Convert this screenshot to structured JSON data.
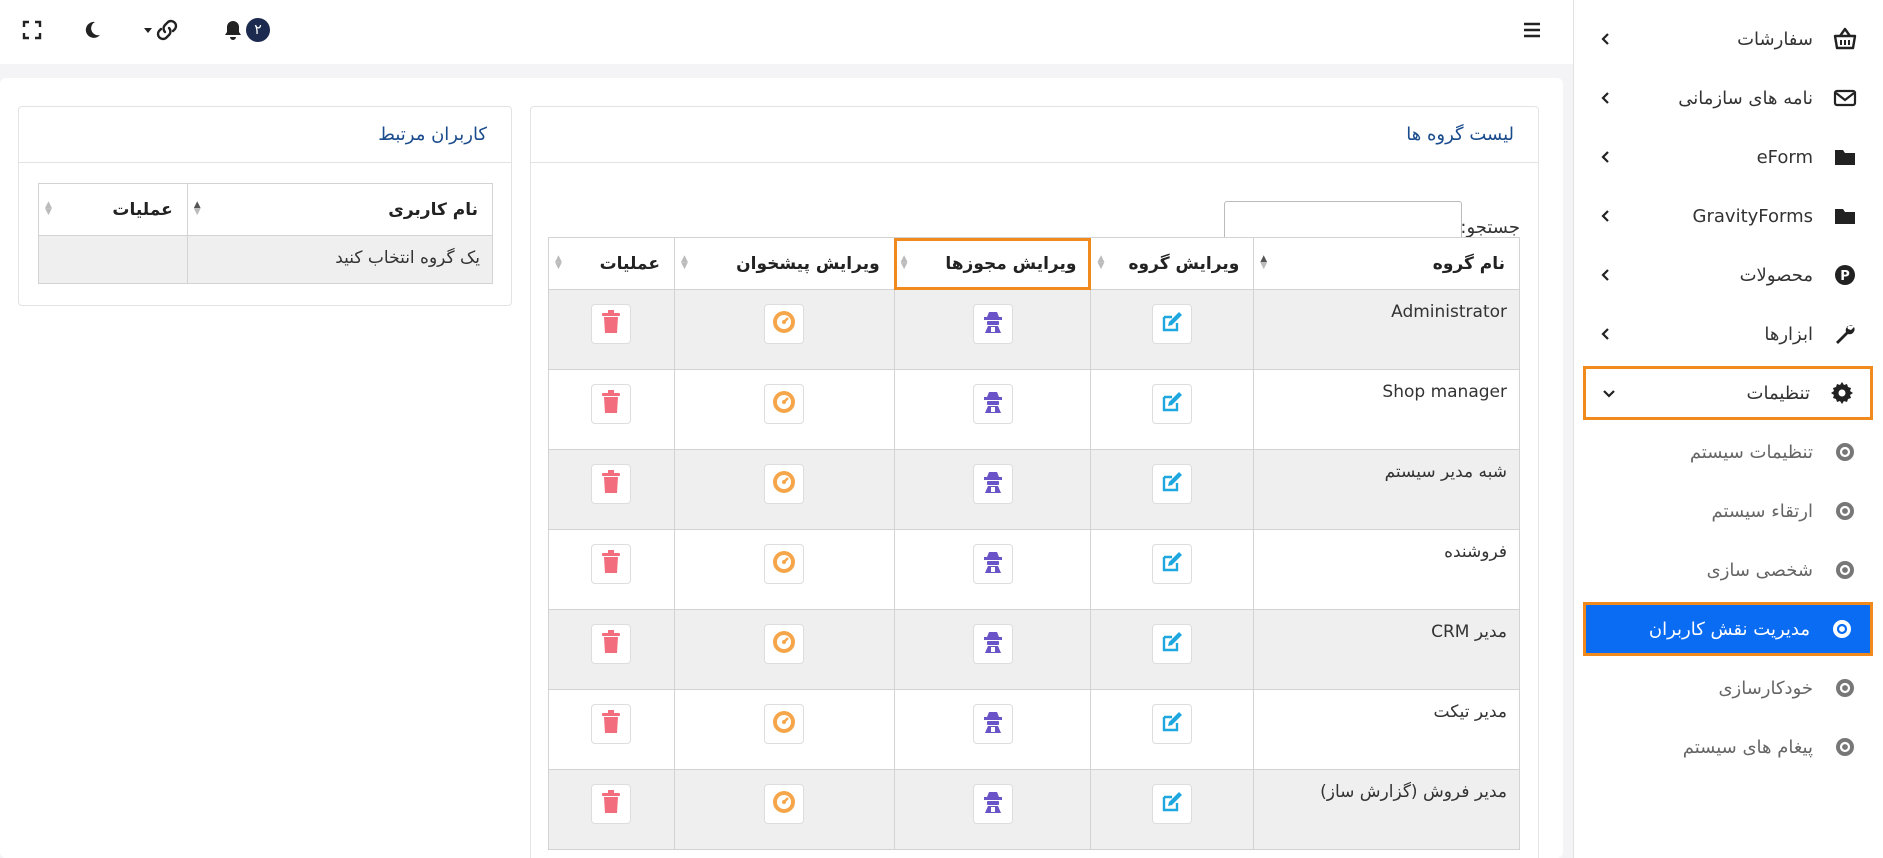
{
  "sidebar": {
    "items": [
      {
        "label": "سفارشات",
        "icon": "basket-icon"
      },
      {
        "label": "نامه های سازمانی",
        "icon": "envelope-icon"
      },
      {
        "label": "eForm",
        "icon": "folder-icon"
      },
      {
        "label": "GravityForms",
        "icon": "folder-icon"
      },
      {
        "label": "محصولات",
        "icon": "product-p-icon"
      },
      {
        "label": "ابزارها",
        "icon": "wrench-icon"
      },
      {
        "label": "تنظیمات",
        "icon": "gear-icon"
      }
    ],
    "sub_items": [
      {
        "label": "تنظیمات سیستم"
      },
      {
        "label": "ارتقاء سیستم"
      },
      {
        "label": "شخصی سازی"
      },
      {
        "label": "مدیریت نقش کاربران"
      },
      {
        "label": "خودکارسازی"
      },
      {
        "label": "پیغام های سیستم"
      }
    ]
  },
  "topbar": {
    "notification_count": "۲"
  },
  "groups_card": {
    "title": "لیست گروه ها",
    "search_label": "جستجو:",
    "search_value": "",
    "columns": [
      "نام گروه",
      "ویرایش گروه",
      "ویرایش مجوزها",
      "ویرایش پیشخوان",
      "عملیات"
    ],
    "rows": [
      {
        "name": "Administrator"
      },
      {
        "name": "Shop manager"
      },
      {
        "name": "شبه مدیر سیستم"
      },
      {
        "name": "فروشنده"
      },
      {
        "name": "مدیر CRM"
      },
      {
        "name": "مدیر تیکت"
      },
      {
        "name": "مدیر فروش (گزارش ساز)"
      }
    ]
  },
  "users_card": {
    "title": "کاربران مرتبط",
    "columns": [
      "نام کاربری",
      "عملیات"
    ],
    "empty_text": "یک گروه انتخاب کنید"
  },
  "colors": {
    "accent_orange": "#f08a1c",
    "active_blue": "#0a6cf2",
    "edit_blue": "#1fa8e0",
    "perm_purple": "#6a54c8",
    "dash_orange": "#f5a64b",
    "delete_red": "#f26d7d"
  }
}
